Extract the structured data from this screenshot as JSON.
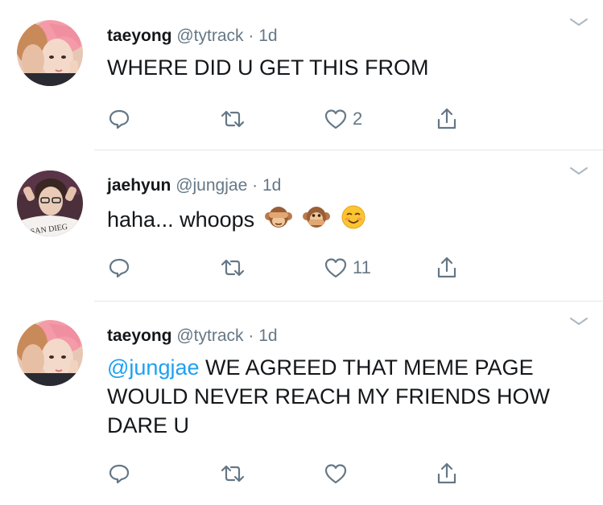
{
  "tweets": [
    {
      "name": "taeyong",
      "handle": "@tytrack",
      "dot": "·",
      "time": "1d",
      "mention": "",
      "text": "WHERE DID U GET THIS FROM",
      "emojis": [],
      "likes": "2"
    },
    {
      "name": "jaehyun",
      "handle": "@jungjae",
      "dot": "·",
      "time": "1d",
      "mention": "",
      "text": "haha... whoops",
      "emojis": [
        "see-no-evil-monkey",
        "speak-no-evil-monkey",
        "smiling-face"
      ],
      "avatar_shirt_text": "SAN DIEG",
      "likes": "11"
    },
    {
      "name": "taeyong",
      "handle": "@tytrack",
      "dot": "·",
      "time": "1d",
      "mention": "@jungjae",
      "text": " WE AGREED THAT MEME PAGE WOULD NEVER REACH MY FRIENDS HOW DARE U",
      "emojis": [],
      "likes": ""
    }
  ],
  "colors": {
    "icon": "#657786",
    "mention": "#1da1f2",
    "divider": "#e1e8ed",
    "name": "#14171a"
  },
  "icons": [
    "reply-icon",
    "retweet-icon",
    "like-icon",
    "share-icon",
    "chevron-down-icon"
  ]
}
